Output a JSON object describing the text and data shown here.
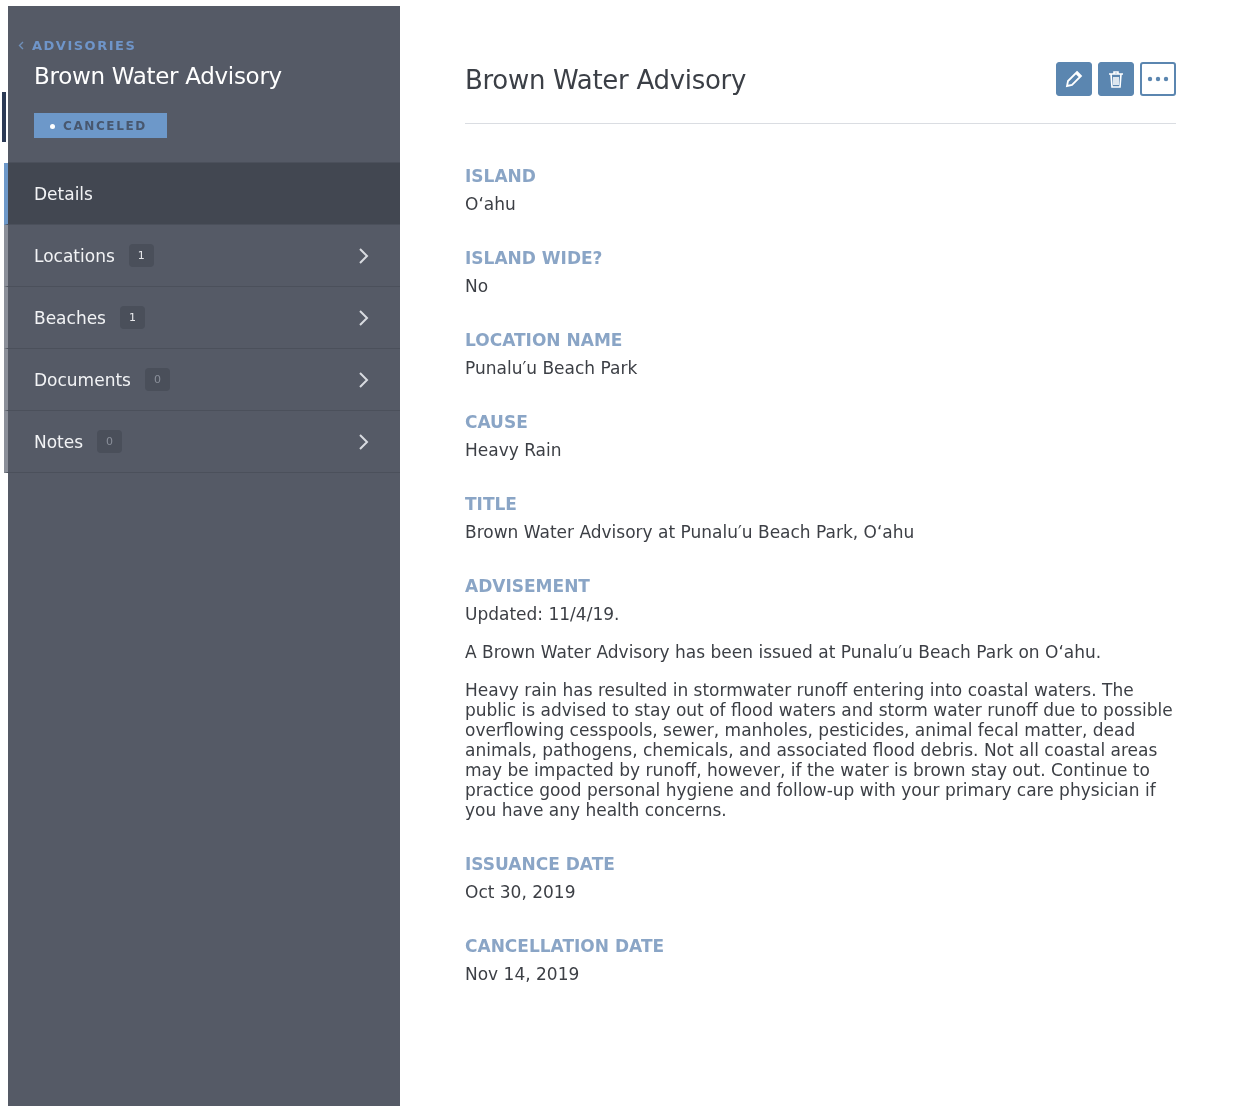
{
  "sidebar": {
    "back_link": "ADVISORIES",
    "title": "Brown Water Advisory",
    "status": "CANCELED",
    "nav": [
      {
        "label": "Details",
        "selected": true
      },
      {
        "label": "Locations",
        "count": "1",
        "selected": false
      },
      {
        "label": "Beaches",
        "count": "1",
        "selected": false
      },
      {
        "label": "Documents",
        "count": "0",
        "selected": false
      },
      {
        "label": "Notes",
        "count": "0",
        "selected": false
      }
    ]
  },
  "main": {
    "title": "Brown Water Advisory",
    "fields": [
      {
        "label": "ISLAND",
        "paragraphs": [
          "O‘ahu"
        ]
      },
      {
        "label": "ISLAND WIDE?",
        "paragraphs": [
          "No"
        ]
      },
      {
        "label": "LOCATION NAME",
        "paragraphs": [
          "Punalu′u Beach Park"
        ]
      },
      {
        "label": "CAUSE",
        "paragraphs": [
          "Heavy Rain"
        ]
      },
      {
        "label": "TITLE",
        "paragraphs": [
          "Brown Water Advisory at Punalu′u Beach Park, O‘ahu"
        ]
      },
      {
        "label": "ADVISEMENT",
        "paragraphs": [
          "Updated: 11/4/19.",
          "A Brown Water Advisory has been issued at Punalu′u Beach Park on O‘ahu.",
          "Heavy rain has resulted in stormwater runoff entering into coastal waters. The public is advised to stay out of flood waters and storm water runoff due to possible overflowing cesspools, sewer, manholes, pesticides, animal fecal matter, dead animals, pathogens, chemicals, and associated flood debris. Not all coastal areas may be impacted by runoff, however, if the water is brown stay out. Continue to practice good personal hygiene and follow-up with your primary care physician if you have any health concerns."
        ]
      },
      {
        "label": "ISSUANCE DATE",
        "paragraphs": [
          "Oct 30, 2019"
        ]
      },
      {
        "label": "CANCELLATION DATE",
        "paragraphs": [
          "Nov 14, 2019"
        ]
      }
    ]
  }
}
